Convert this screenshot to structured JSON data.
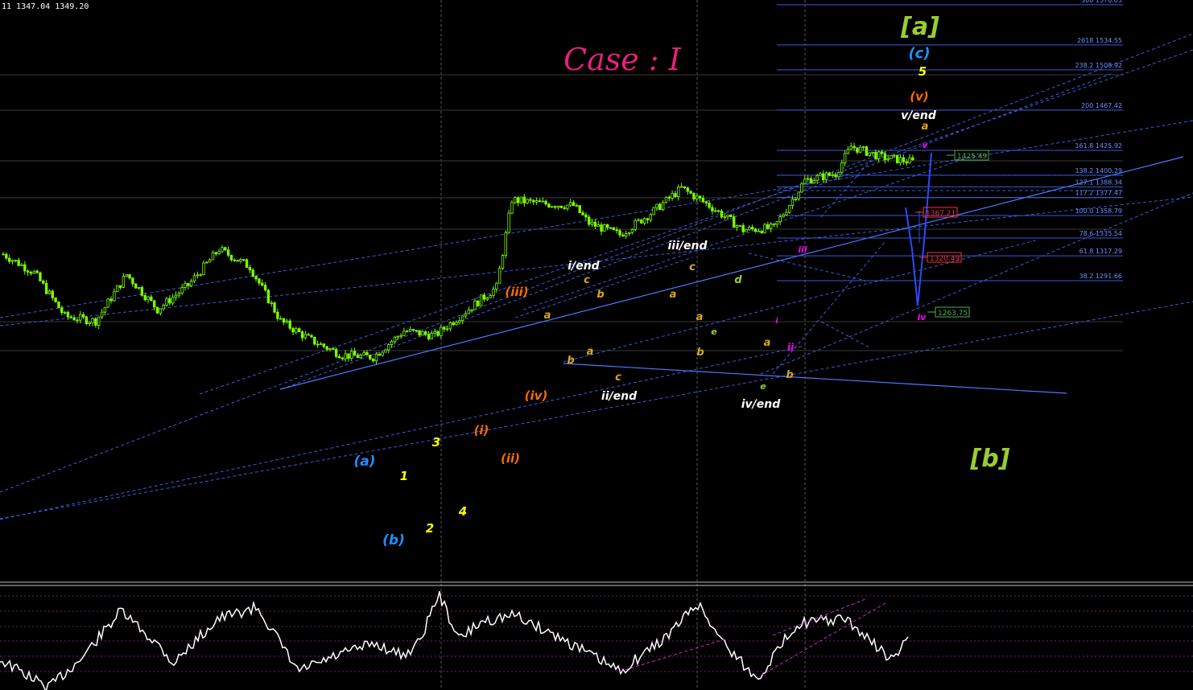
{
  "header": {
    "symbol_info": "11 1347.04 1349.20"
  },
  "title": "Case : I",
  "colors": {
    "background": "#000000",
    "candle": "#7CFC00",
    "fib_line": "#3a5ad8",
    "trend_line": "#4a7aff",
    "oscillator": "#ffffff",
    "osc_channel": "#c030c0",
    "green_label": "#9acd32",
    "blue_label": "#1e90ff",
    "yellow_label": "#ffff00",
    "orange_label": "#ff6a00",
    "tan_label": "#daa520",
    "white_label": "#ffffff",
    "magenta_label": "#ff00ff"
  },
  "chart_data": {
    "type": "candlestick",
    "title": "Case : I",
    "ylim": [
      1180,
      1590
    ],
    "grid": "vertical dashed",
    "fib_levels": [
      {
        "label": "300",
        "price": 1576.05
      },
      {
        "label": "2618",
        "price": 1534.55
      },
      {
        "label": "238.2",
        "price": 1508.92
      },
      {
        "label": "200",
        "price": 1467.42
      },
      {
        "label": "161.8",
        "price": 1425.92
      },
      {
        "label": "138.2",
        "price": 1400.29
      },
      {
        "label": "127.1",
        "price": 1388.34
      },
      {
        "label": "117.2",
        "price": 1377.47
      },
      {
        "label": "100.0",
        "price": 1358.79
      },
      {
        "label": "78.6",
        "price": 1335.54
      },
      {
        "label": "61.8",
        "price": 1317.29
      },
      {
        "label": "38.2",
        "price": 1291.66
      }
    ],
    "price_boxes": [
      {
        "text": "1425.49",
        "price": 1425.49,
        "color": "#4caf50"
      },
      {
        "text": "1367.21",
        "price": 1367.21,
        "color": "#ff3030"
      },
      {
        "text": "1320.49",
        "price": 1320.49,
        "color": "#ff3030"
      },
      {
        "text": "1263.75",
        "price": 1263.75,
        "color": "#4caf50"
      }
    ],
    "wave_labels": [
      {
        "text": "[a]",
        "color": "#9acd32"
      },
      {
        "text": "[b]",
        "color": "#9acd32"
      },
      {
        "text": "(c)",
        "color": "#1e90ff"
      },
      {
        "text": "(a)",
        "color": "#1e90ff"
      },
      {
        "text": "(b)",
        "color": "#1e90ff"
      },
      {
        "text": "5",
        "color": "#ffff00"
      },
      {
        "text": "1",
        "color": "#ffff00"
      },
      {
        "text": "2",
        "color": "#ffff00"
      },
      {
        "text": "3",
        "color": "#ffff00"
      },
      {
        "text": "4",
        "color": "#ffff00"
      },
      {
        "text": "(v)",
        "color": "#ff6a00"
      },
      {
        "text": "(i)",
        "color": "#ff6a00"
      },
      {
        "text": "(ii)",
        "color": "#ff6a00"
      },
      {
        "text": "(iii)",
        "color": "#ff6a00"
      },
      {
        "text": "(iv)",
        "color": "#ff6a00"
      },
      {
        "text": "v/end",
        "color": "#ffffff"
      },
      {
        "text": "i/end",
        "color": "#ffffff"
      },
      {
        "text": "ii/end",
        "color": "#ffffff"
      },
      {
        "text": "iii/end",
        "color": "#ffffff"
      },
      {
        "text": "iv/end",
        "color": "#ffffff"
      },
      {
        "text": "a",
        "color": "#daa520"
      },
      {
        "text": "b",
        "color": "#daa520"
      },
      {
        "text": "c",
        "color": "#daa520"
      },
      {
        "text": "d",
        "color": "#9acd32"
      },
      {
        "text": "e",
        "color": "#9acd32"
      },
      {
        "text": "i",
        "color": "#ff00ff"
      },
      {
        "text": "ii",
        "color": "#ff00ff"
      },
      {
        "text": "iii",
        "color": "#ff00ff"
      },
      {
        "text": "iv",
        "color": "#ff00ff"
      },
      {
        "text": "v",
        "color": "#ff00ff"
      }
    ],
    "price_path": [
      {
        "bar": 0,
        "close": 1319
      },
      {
        "bar": 10,
        "close": 1300
      },
      {
        "bar": 20,
        "close": 1255
      },
      {
        "bar": 30,
        "close": 1250
      },
      {
        "bar": 40,
        "close": 1298
      },
      {
        "bar": 50,
        "close": 1262
      },
      {
        "bar": 60,
        "close": 1287
      },
      {
        "bar": 70,
        "close": 1324
      },
      {
        "bar": 80,
        "close": 1306
      },
      {
        "bar": 90,
        "close": 1250
      },
      {
        "bar": 100,
        "close": 1230
      },
      {
        "bar": 110,
        "close": 1215
      },
      {
        "bar": 120,
        "close": 1213
      },
      {
        "bar": 130,
        "close": 1240
      },
      {
        "bar": 140,
        "close": 1235
      },
      {
        "bar": 150,
        "close": 1260
      },
      {
        "bar": 160,
        "close": 1285
      },
      {
        "bar": 165,
        "close": 1375
      },
      {
        "bar": 175,
        "close": 1371
      },
      {
        "bar": 185,
        "close": 1369
      },
      {
        "bar": 190,
        "close": 1351
      },
      {
        "bar": 200,
        "close": 1339
      },
      {
        "bar": 210,
        "close": 1361
      },
      {
        "bar": 220,
        "close": 1387
      },
      {
        "bar": 230,
        "close": 1367
      },
      {
        "bar": 240,
        "close": 1344
      },
      {
        "bar": 250,
        "close": 1346
      },
      {
        "bar": 260,
        "close": 1395
      },
      {
        "bar": 270,
        "close": 1402
      },
      {
        "bar": 275,
        "close": 1430
      },
      {
        "bar": 285,
        "close": 1419
      },
      {
        "bar": 295,
        "close": 1414
      }
    ]
  }
}
